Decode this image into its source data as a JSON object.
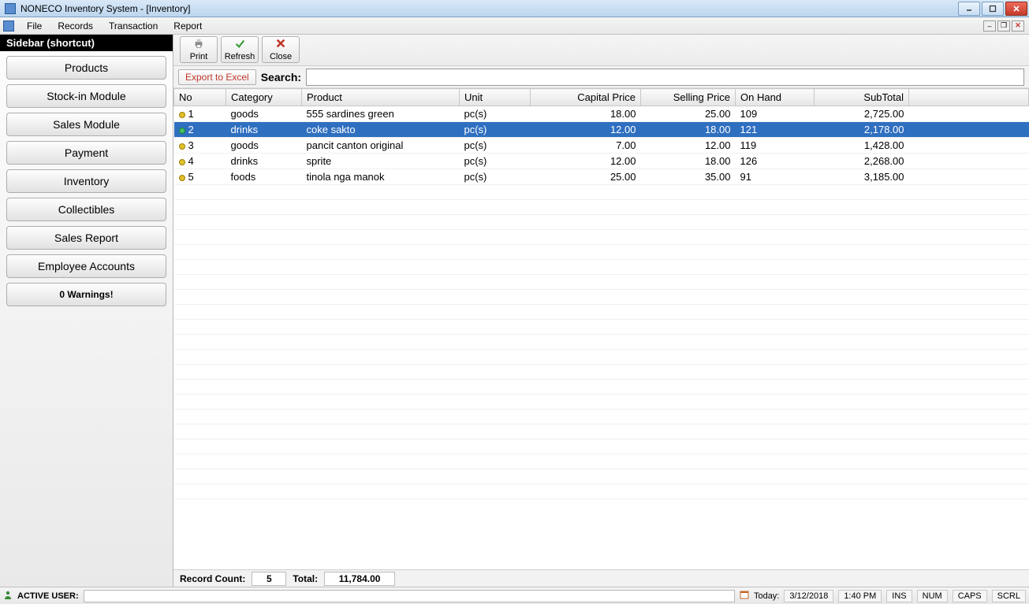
{
  "window": {
    "title": "NONECO Inventory System - [Inventory]"
  },
  "menu": {
    "items": [
      "File",
      "Records",
      "Transaction",
      "Report"
    ]
  },
  "sidebar": {
    "header": "Sidebar (shortcut)",
    "buttons": [
      "Products",
      "Stock-in Module",
      "Sales Module",
      "Payment",
      "Inventory",
      "Collectibles",
      "Sales Report",
      "Employee Accounts"
    ],
    "warnings": "0 Warnings!"
  },
  "toolbar": {
    "print": "Print",
    "refresh": "Refresh",
    "close": "Close"
  },
  "search": {
    "export": "Export to Excel",
    "label": "Search:",
    "value": ""
  },
  "grid": {
    "headers": {
      "no": "No",
      "category": "Category",
      "product": "Product",
      "unit": "Unit",
      "capital": "Capital Price",
      "selling": "Selling Price",
      "onhand": "On Hand",
      "subtotal": "SubTotal"
    },
    "rows": [
      {
        "no": "1",
        "category": "goods",
        "product": "555 sardines green",
        "unit": "pc(s)",
        "capital": "18.00",
        "selling": "25.00",
        "onhand": "109",
        "subtotal": "2,725.00",
        "selected": false
      },
      {
        "no": "2",
        "category": "drinks",
        "product": "coke sakto",
        "unit": "pc(s)",
        "capital": "12.00",
        "selling": "18.00",
        "onhand": "121",
        "subtotal": "2,178.00",
        "selected": true
      },
      {
        "no": "3",
        "category": "goods",
        "product": "pancit canton original",
        "unit": "pc(s)",
        "capital": "7.00",
        "selling": "12.00",
        "onhand": "119",
        "subtotal": "1,428.00",
        "selected": false
      },
      {
        "no": "4",
        "category": "drinks",
        "product": "sprite",
        "unit": "pc(s)",
        "capital": "12.00",
        "selling": "18.00",
        "onhand": "126",
        "subtotal": "2,268.00",
        "selected": false
      },
      {
        "no": "5",
        "category": "foods",
        "product": "tinola nga manok",
        "unit": "pc(s)",
        "capital": "25.00",
        "selling": "35.00",
        "onhand": "91",
        "subtotal": "3,185.00",
        "selected": false
      }
    ],
    "footer": {
      "record_label": "Record Count:",
      "record_value": "5",
      "total_label": "Total:",
      "total_value": "11,784.00"
    }
  },
  "status": {
    "active_user_label": "ACTIVE USER:",
    "today_label": "Today:",
    "date": "3/12/2018",
    "time": "1:40 PM",
    "indicators": [
      "INS",
      "NUM",
      "CAPS",
      "SCRL"
    ]
  }
}
